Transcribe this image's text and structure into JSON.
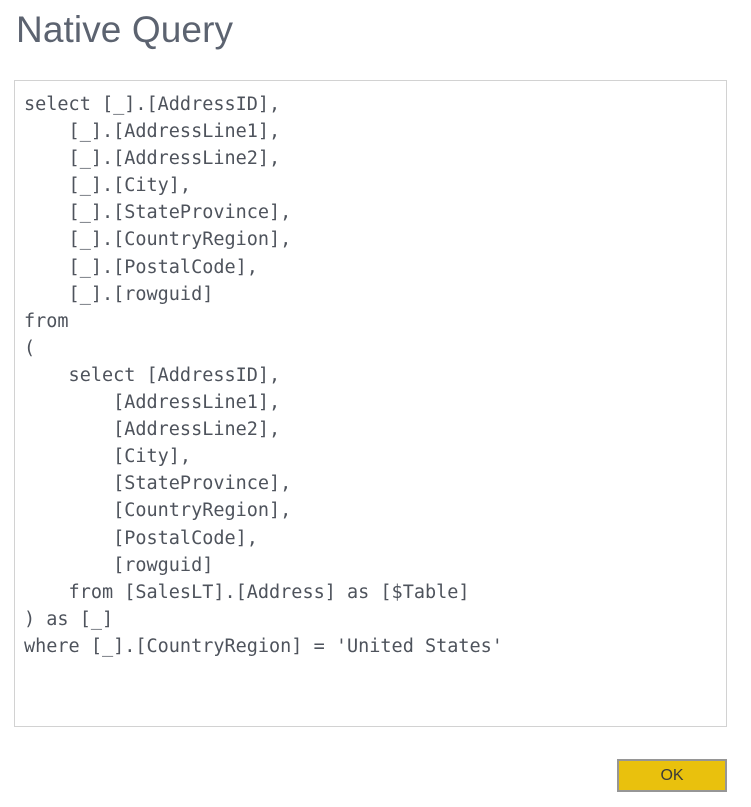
{
  "dialog": {
    "title": "Native Query",
    "accent_color": "#e9c10d",
    "border_color": "#d2d2d2",
    "title_color": "#5c6370",
    "code_color": "#4e535c"
  },
  "query": {
    "language": "sql",
    "text": "select [_].[AddressID],\n    [_].[AddressLine1],\n    [_].[AddressLine2],\n    [_].[City],\n    [_].[StateProvince],\n    [_].[CountryRegion],\n    [_].[PostalCode],\n    [_].[rowguid]\nfrom\n(\n    select [AddressID],\n        [AddressLine1],\n        [AddressLine2],\n        [City],\n        [StateProvince],\n        [CountryRegion],\n        [PostalCode],\n        [rowguid]\n    from [SalesLT].[Address] as [$Table]\n) as [_]\nwhere [_].[CountryRegion] = 'United States'",
    "lines": [
      "select [_].[AddressID],",
      "    [_].[AddressLine1],",
      "    [_].[AddressLine2],",
      "    [_].[City],",
      "    [_].[StateProvince],",
      "    [_].[CountryRegion],",
      "    [_].[PostalCode],",
      "    [_].[rowguid]",
      "from",
      "(",
      "    select [AddressID],",
      "        [AddressLine1],",
      "        [AddressLine2],",
      "        [City],",
      "        [StateProvince],",
      "        [CountryRegion],",
      "        [PostalCode],",
      "        [rowguid]",
      "    from [SalesLT].[Address] as [$Table]",
      ") as [_]",
      "where [_].[CountryRegion] = 'United States'"
    ]
  },
  "footer": {
    "ok_label": "OK"
  }
}
